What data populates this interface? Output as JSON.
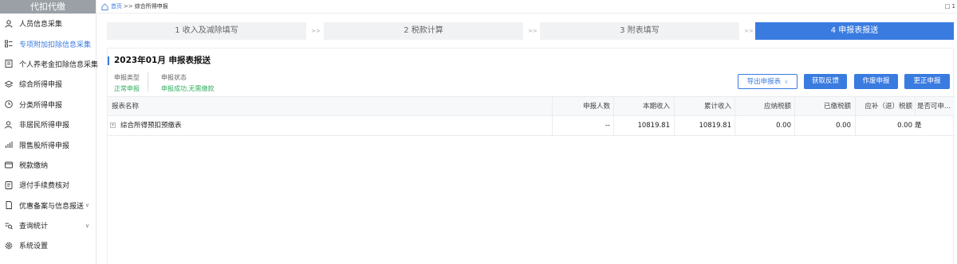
{
  "sidebar": {
    "header": "代扣代缴",
    "items": [
      {
        "label": "人员信息采集",
        "icon": "person-icon",
        "active": false
      },
      {
        "label": "专项附加扣除信息采集",
        "icon": "list-icon",
        "active": true
      },
      {
        "label": "个人养老金扣除信息采集",
        "icon": "document-icon",
        "active": false
      },
      {
        "label": "综合所得申报",
        "icon": "layers-icon",
        "active": false
      },
      {
        "label": "分类所得申报",
        "icon": "clock-icon",
        "active": false
      },
      {
        "label": "非居民所得申报",
        "icon": "user-icon",
        "active": false
      },
      {
        "label": "限售股所得申报",
        "icon": "bar-chart-icon",
        "active": false
      },
      {
        "label": "税款缴纳",
        "icon": "wallet-icon",
        "active": false
      },
      {
        "label": "退付手续费核对",
        "icon": "receipt-icon",
        "active": false
      },
      {
        "label": "优惠备案与信息报送",
        "icon": "file-icon",
        "active": false,
        "expandable": true
      },
      {
        "label": "查询统计",
        "icon": "search-list-icon",
        "active": false,
        "expandable": true
      },
      {
        "label": "系统设置",
        "icon": "gear-icon",
        "active": false
      }
    ]
  },
  "breadcrumb": {
    "home": "首页",
    "separator": ">>",
    "current": "综合所得申报"
  },
  "window_ctrl": "□ 1",
  "steps": [
    {
      "label": "1 收入及减除填写",
      "active": false
    },
    {
      "label": "2 税款计算",
      "active": false
    },
    {
      "label": "3 附表填写",
      "active": false
    },
    {
      "label": "4 申报表报送",
      "active": true
    }
  ],
  "step_separator": ">>",
  "period": {
    "title": "2023年01月  申报表报送"
  },
  "info": {
    "type_label": "申报类型",
    "type_value": "正常申报",
    "status_label": "申报状态",
    "status_value": "申报成功,无需缴款"
  },
  "actions": {
    "export": "导出申报表",
    "feedback": "获取反馈",
    "void": "作废申报",
    "correct": "更正申报"
  },
  "table": {
    "headers": [
      "报表名称",
      "申报人数",
      "本期收入",
      "累计收入",
      "应纳税额",
      "已缴税额",
      "应补（退）税额",
      "是否可申..."
    ],
    "rows": [
      {
        "expand": "+",
        "name": "综合所得预扣预缴表",
        "count": "--",
        "income": "10819.81",
        "cumulative": "10819.81",
        "tax_due": "0.00",
        "tax_paid": "0.00",
        "refund": "0.00",
        "can_declare": "是"
      }
    ]
  },
  "colors": {
    "accent": "#3a7be0",
    "success": "#2fae5f",
    "sidebar_header": "#9aa0a6"
  }
}
